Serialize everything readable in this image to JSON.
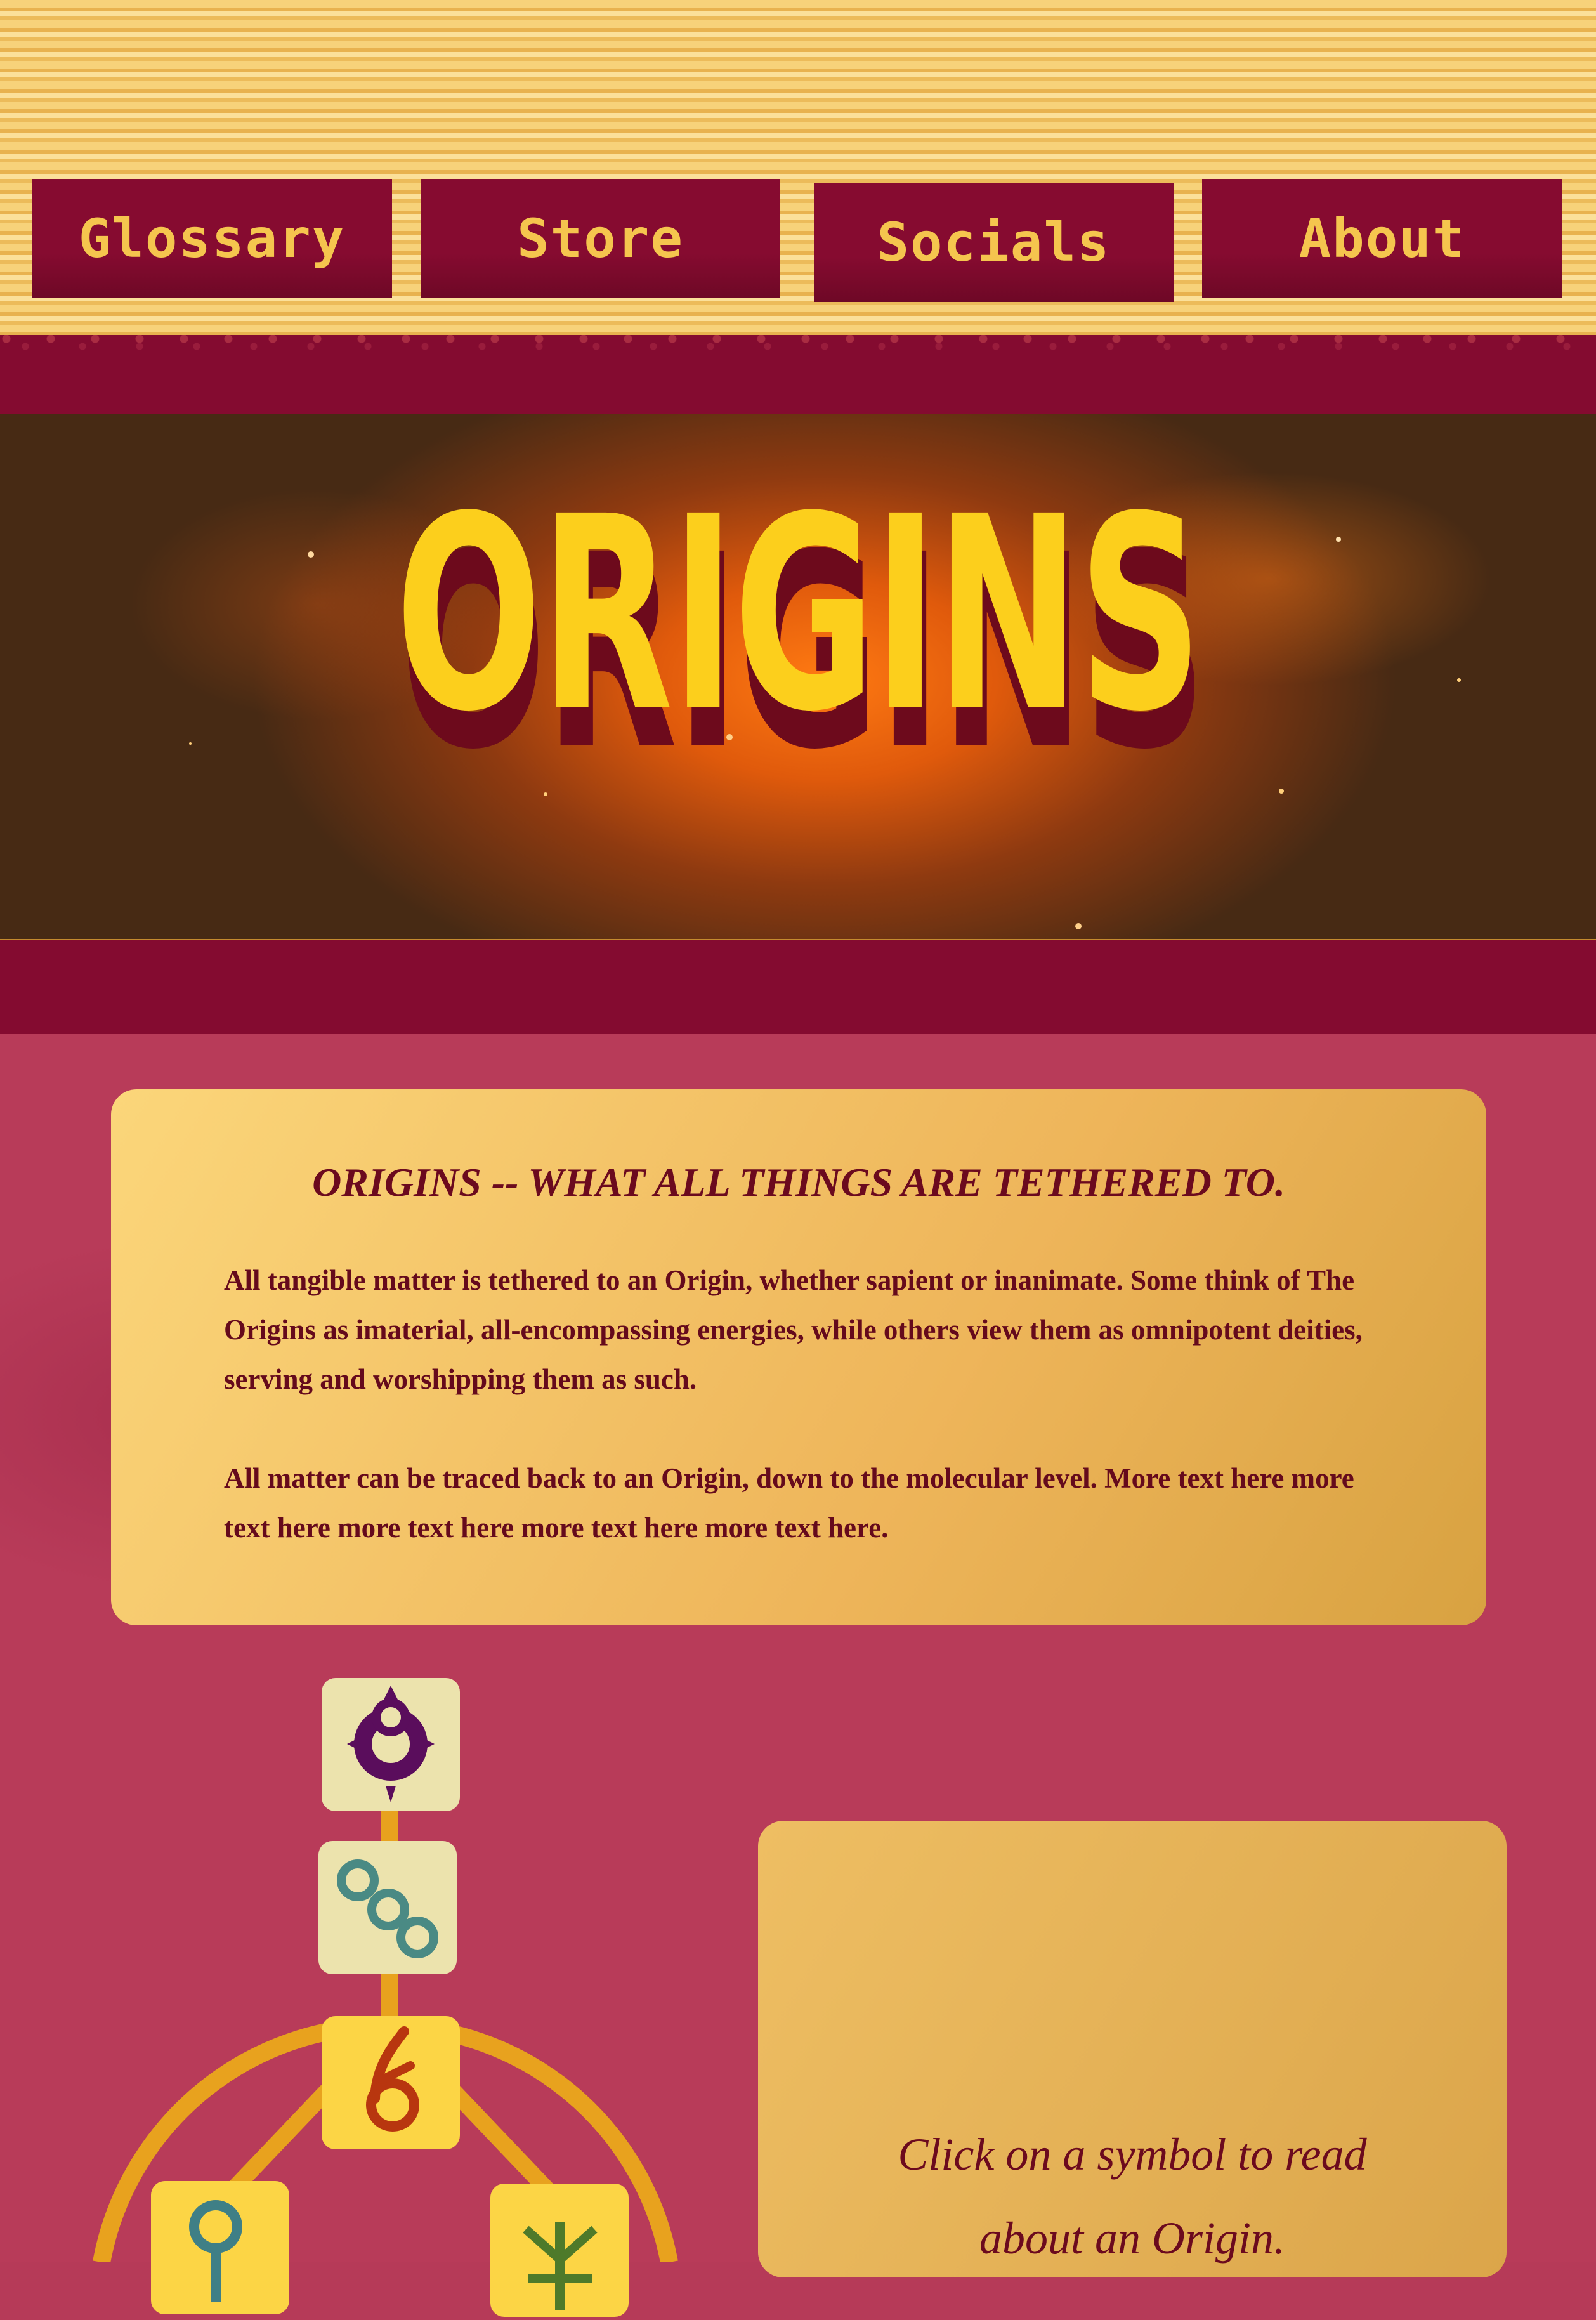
{
  "nav": {
    "items": [
      {
        "label": "Glossary"
      },
      {
        "label": "Store"
      },
      {
        "label": "Socials"
      },
      {
        "label": "About"
      }
    ]
  },
  "hero": {
    "title": "ORIGINS"
  },
  "intro": {
    "heading": "ORIGINS -- WHAT ALL THINGS ARE TETHERED TO.",
    "paragraph1": "All tangible matter is tethered to an Origin, whether sapient or inanimate. Some think of The Origins as imaterial, all-encompassing energies, while others view them as omnipotent deities, serving and worshipping them as such.",
    "paragraph2": "All matter can be traced back to an Origin, down to the molecular level. More text here more text here more text here more text here more text here."
  },
  "symbols": [
    {
      "icon": "crowned-circle-symbol-icon",
      "color": "#5a0d5c"
    },
    {
      "icon": "three-rings-symbol-icon",
      "color": "#4a8a84"
    },
    {
      "icon": "flame-six-symbol-icon",
      "color": "#b8360f"
    },
    {
      "icon": "keyhole-symbol-icon",
      "color": "#3f7f86"
    },
    {
      "icon": "sprout-symbol-icon",
      "color": "#4e7a2a"
    }
  ],
  "prompt": {
    "line1": "Click on a symbol to read",
    "line2": "about an Origin."
  },
  "colors": {
    "accent": "#840b30",
    "gold": "#f5c54e",
    "title_yellow": "#fccf1c",
    "background": "#b83b59"
  }
}
